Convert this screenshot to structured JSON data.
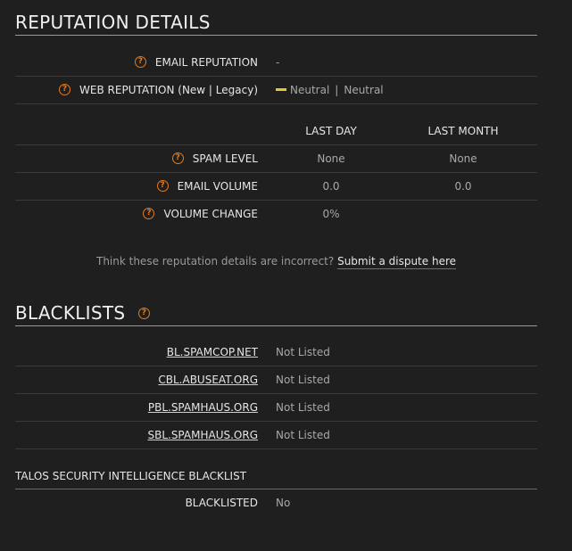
{
  "reputation": {
    "title": "REPUTATION DETAILS",
    "email_label": "EMAIL REPUTATION",
    "email_value": "-",
    "web_label": "WEB REPUTATION (New | Legacy)",
    "web_new": "Neutral",
    "web_sep": "|",
    "web_legacy": "Neutral",
    "col_last_day": "LAST DAY",
    "col_last_month": "LAST MONTH",
    "rows": [
      {
        "label": "SPAM LEVEL",
        "day": "None",
        "month": "None"
      },
      {
        "label": "EMAIL VOLUME",
        "day": "0.0",
        "month": "0.0"
      },
      {
        "label": "VOLUME CHANGE",
        "day": "0%",
        "month": ""
      }
    ],
    "dispute_text": "Think these reputation details are incorrect?",
    "dispute_link": "Submit a dispute here"
  },
  "blacklists": {
    "title": "BLACKLISTS",
    "items": [
      {
        "name": "BL.SPAMCOP.NET",
        "status": "Not Listed"
      },
      {
        "name": "CBL.ABUSEAT.ORG",
        "status": "Not Listed"
      },
      {
        "name": "PBL.SPAMHAUS.ORG",
        "status": "Not Listed"
      },
      {
        "name": "SBL.SPAMHAUS.ORG",
        "status": "Not Listed"
      }
    ]
  },
  "talos": {
    "title": "TALOS SECURITY INTELLIGENCE BLACKLIST",
    "label": "BLACKLISTED",
    "value": "No"
  },
  "colors": {
    "background": "#1f1f1f",
    "accent_help": "#e37b1f",
    "neutral": "#e8c43a",
    "dispute_underline": "#d9482b"
  },
  "icons": {
    "help": "question-mark-circle-icon",
    "neutral": "neutral-bar-icon"
  }
}
